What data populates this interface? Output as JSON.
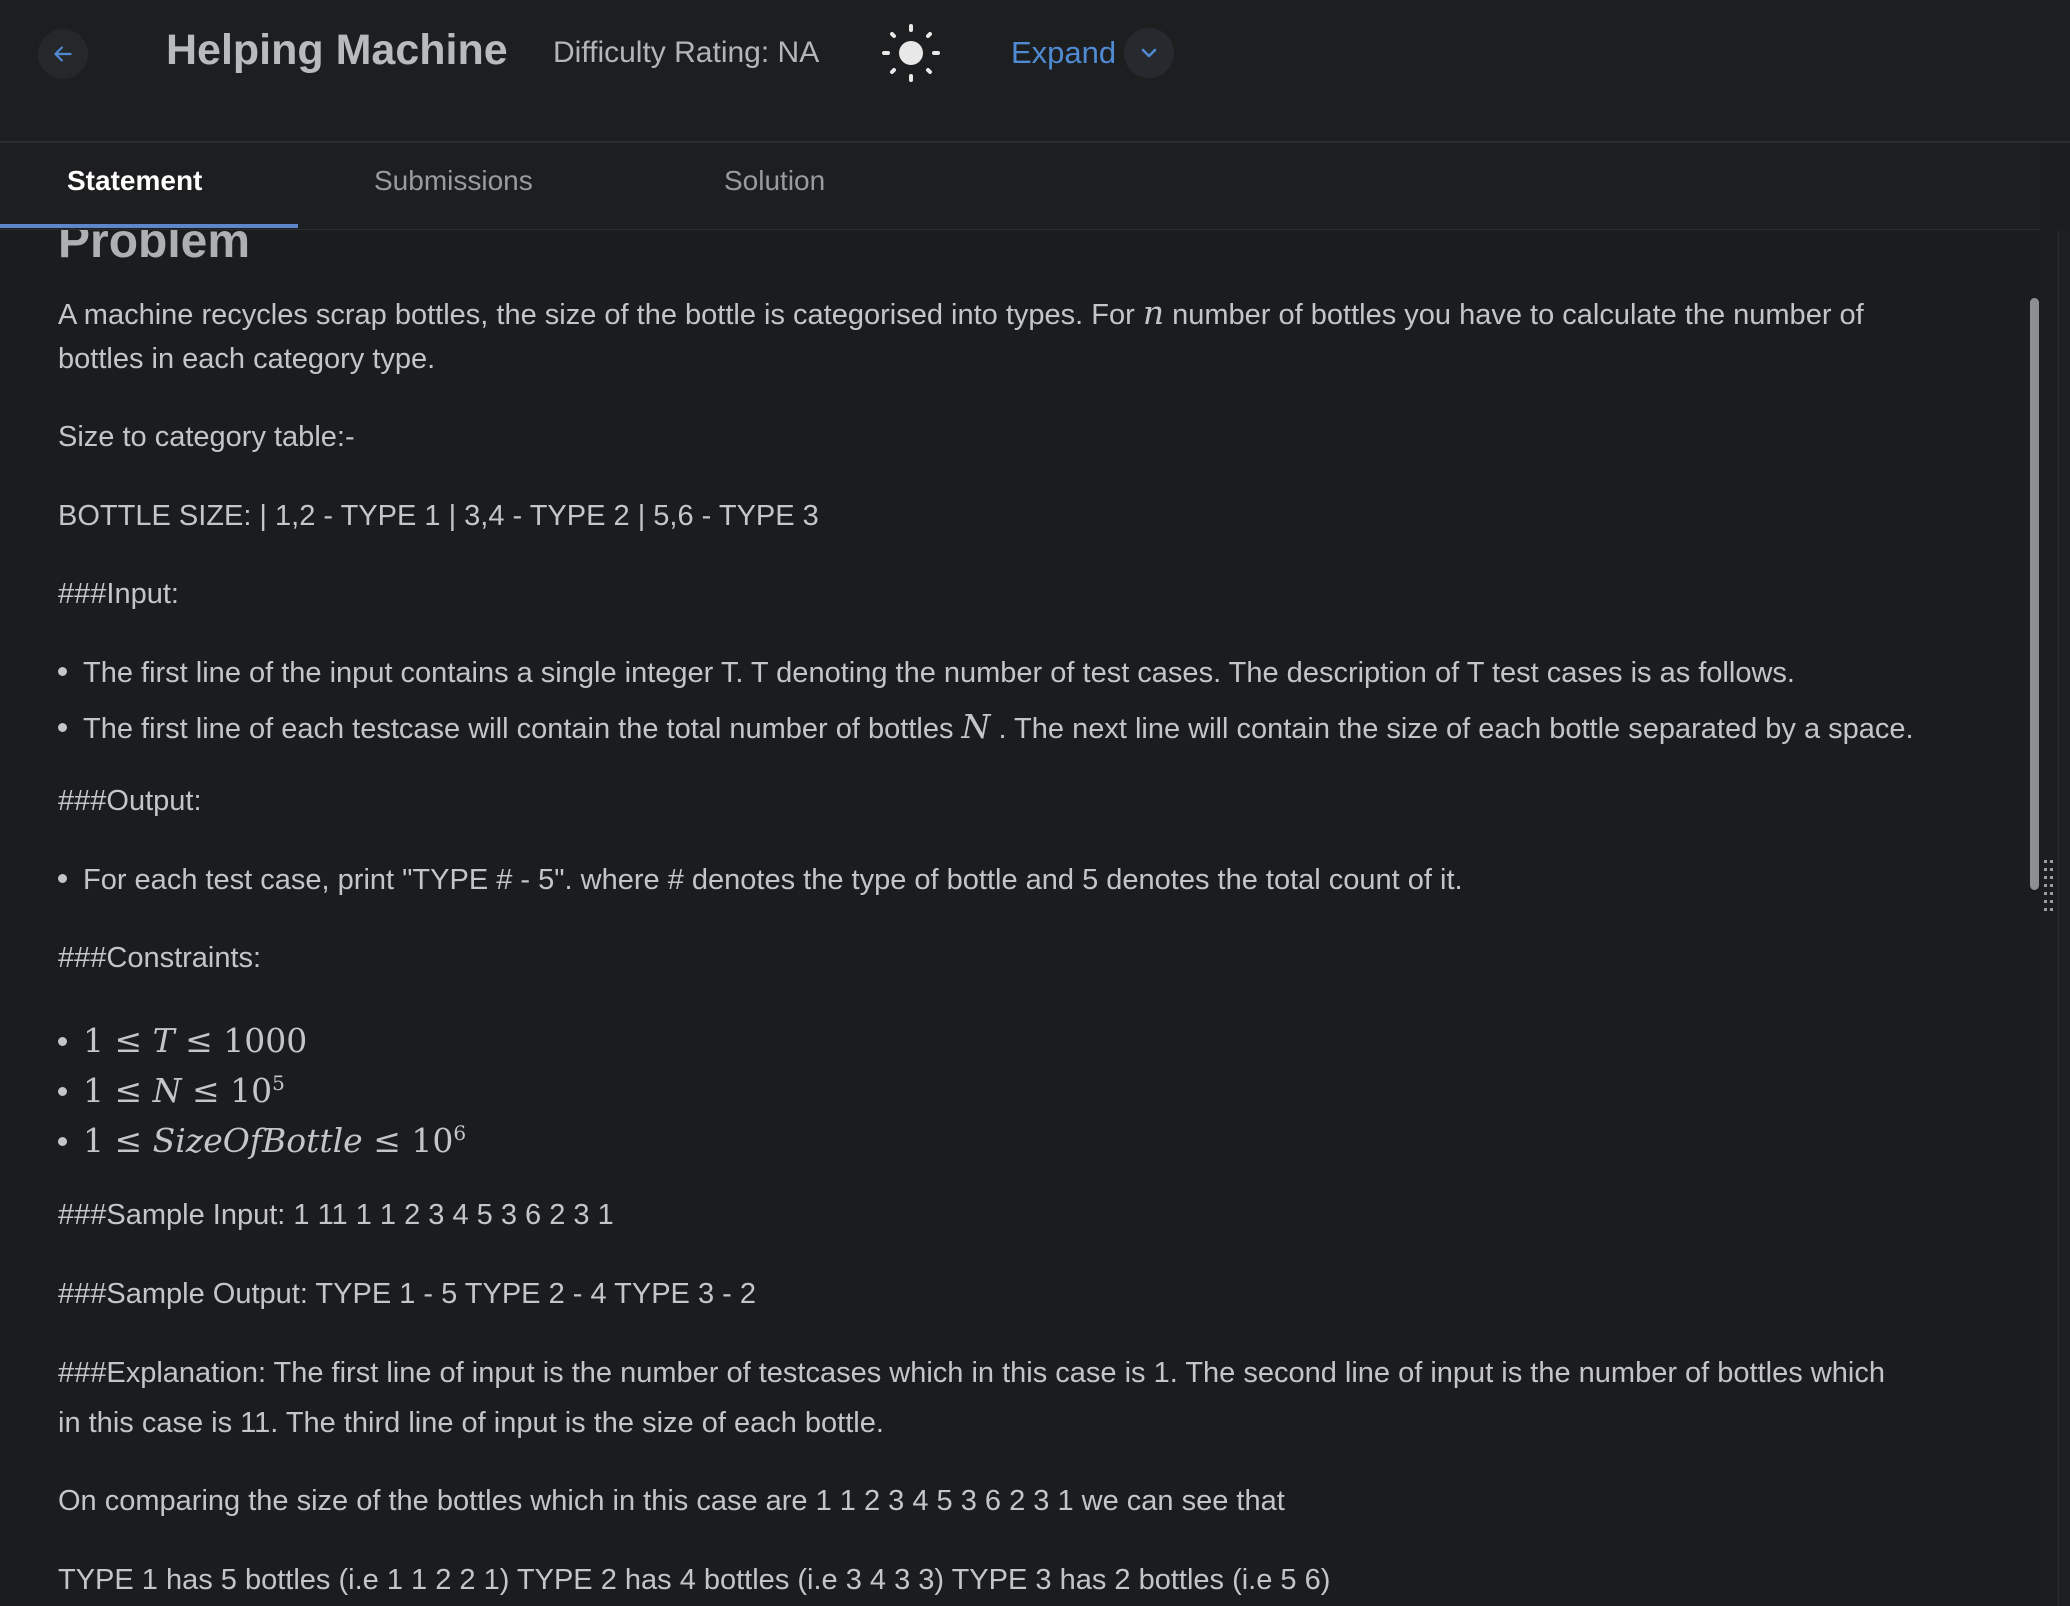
{
  "header": {
    "title": "Helping Machine",
    "difficulty": "Difficulty Rating: NA",
    "expand_label": "Expand",
    "icons": {
      "back": "arrow-left-icon",
      "theme": "sun-icon",
      "expand": "chevron-down-icon"
    },
    "accent_color": "#4f8ad2"
  },
  "tabs": [
    {
      "label": "Statement",
      "active": true
    },
    {
      "label": "Submissions",
      "active": false
    },
    {
      "label": "Solution",
      "active": false
    }
  ],
  "problem": {
    "heading": "Problem",
    "intro_1_a": "A machine recycles scrap bottles, the size of the bottle is categorised into types. For ",
    "intro_var_n": "n",
    "intro_1_b": " number of bottles you have to calculate the number of",
    "intro_2": "bottles in each category type.",
    "size_table_label": "Size to category table:-",
    "bottle_size": "BOTTLE SIZE: | 1,2 - TYPE 1 | 3,4 - TYPE 2 | 5,6 - TYPE 3",
    "input_heading": "###Input:",
    "input_bullet_1": "The first line of the input contains a single integer T. T denoting the number of test cases. The description of T test cases is as follows.",
    "input_bullet_2_a": "The first line of each testcase will contain the total number of bottles ",
    "input_bullet_2_var": "N",
    "input_bullet_2_b": " . The next line will contain the size of each bottle separated by a space.",
    "output_heading": "###Output:",
    "output_bullet": "For each test case, print \"TYPE # - 5\". where # denotes the type of bottle and 5 denotes the total count of it.",
    "constraints_heading": "###Constraints:",
    "constraints": [
      {
        "lhs": "1 ≤ ",
        "var": "T",
        "rhs": " ≤ 1000",
        "exp": ""
      },
      {
        "lhs": "1 ≤ ",
        "var": "N",
        "rhs": " ≤ 10",
        "exp": "5"
      },
      {
        "lhs": "1 ≤ ",
        "var": "SizeOfBottle",
        "rhs": " ≤ 10",
        "exp": "6"
      }
    ],
    "sample_input": "###Sample Input: 1 11 1 1 2 3 4 5 3 6 2 3 1",
    "sample_output": "###Sample Output: TYPE 1 - 5 TYPE 2 - 4 TYPE 3 - 2",
    "explanation_1": "###Explanation: The first line of input is the number of testcases which in this case is 1. The second line of input is the number of bottles which",
    "explanation_2": "in this case is 11. The third line of input is the size of each bottle.",
    "comparing": "On comparing the size of the bottles which in this case are 1 1 2 3 4 5 3 6 2 3 1 we can see that",
    "type_summary": "TYPE 1 has 5 bottles (i.e 1 1 2 2 1) TYPE 2 has 4 bottles (i.e 3 4 3 3) TYPE 3 has 2 bottles (i.e 5 6)"
  }
}
